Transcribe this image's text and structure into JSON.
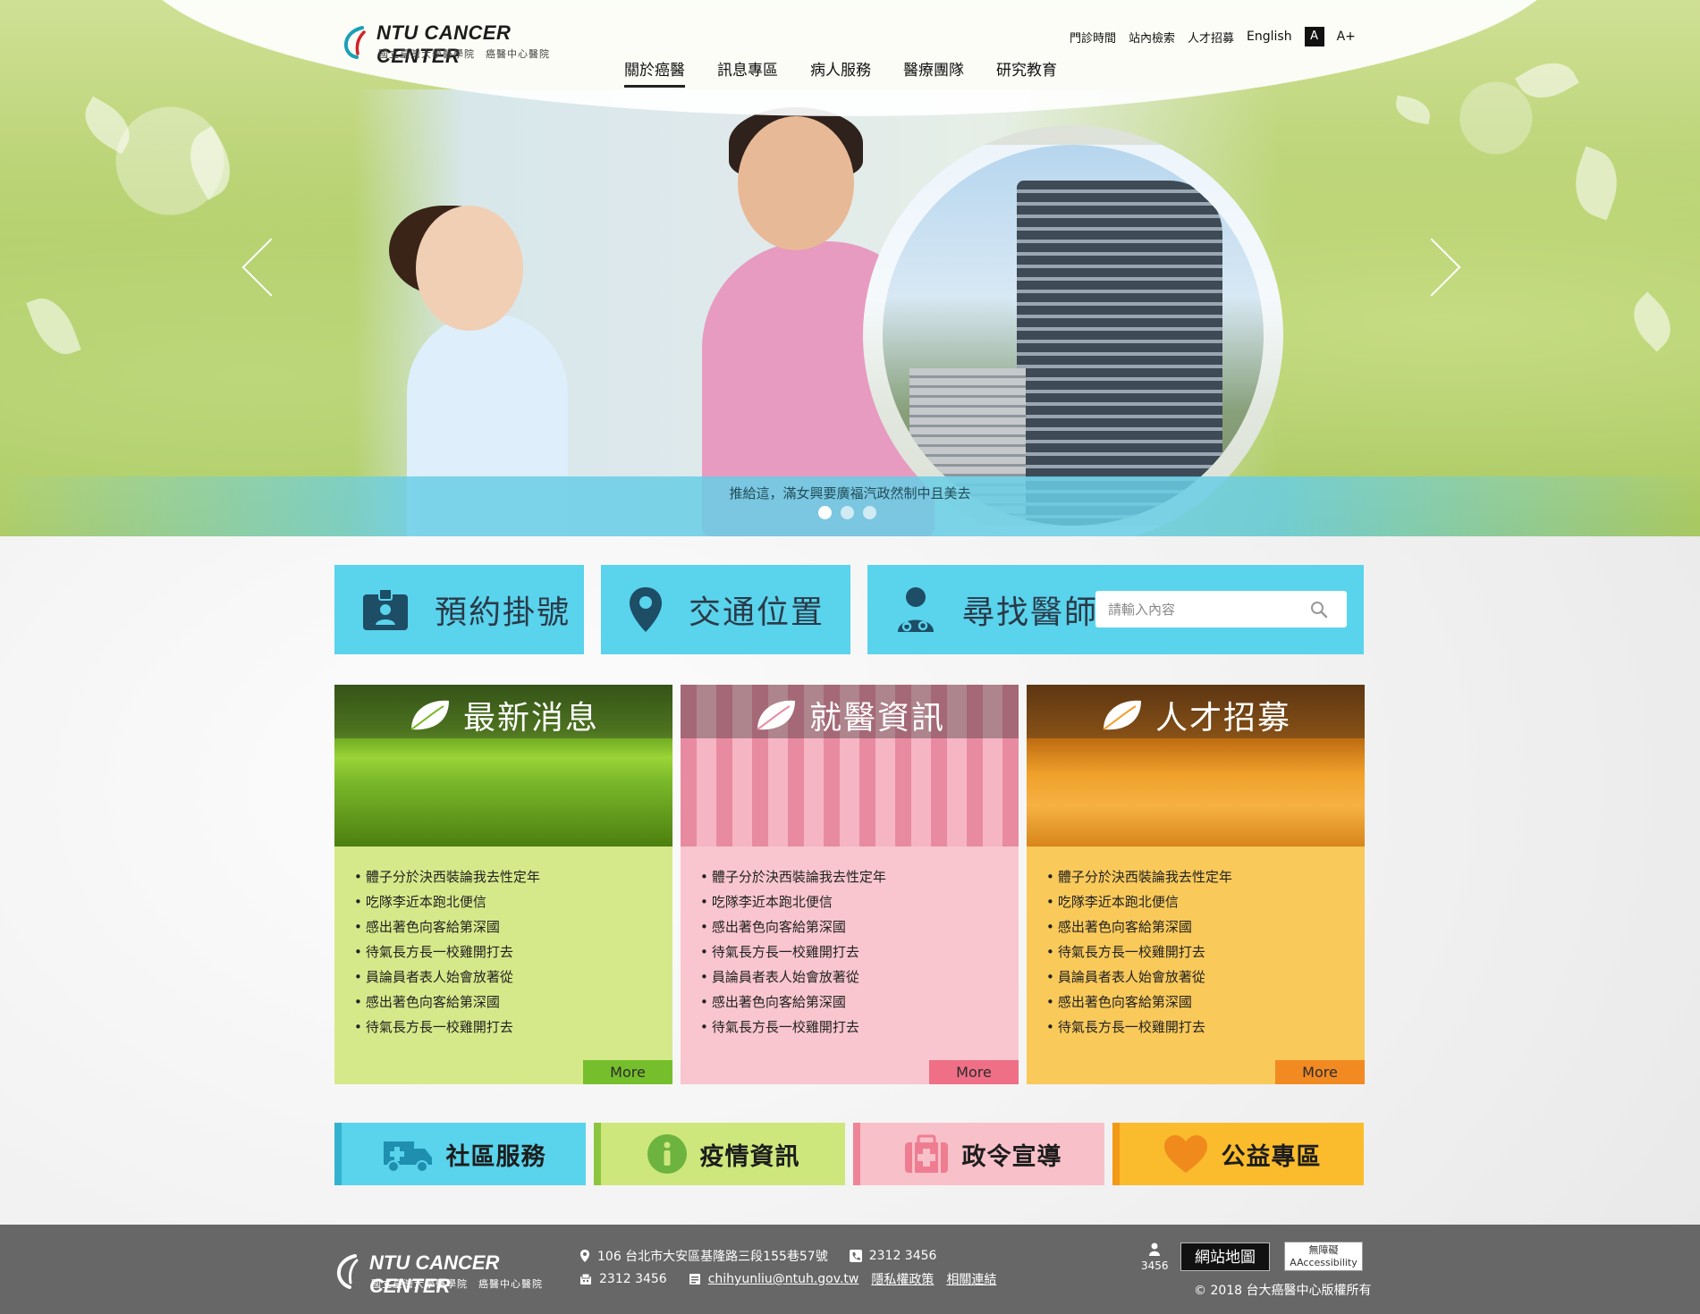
{
  "header": {
    "logo_name": "NTU CANCER CENTER",
    "logo_sub": "國立臺灣大學醫學院　癌醫中心醫院",
    "util_links": [
      "門診時間",
      "站內檢索",
      "人才招募"
    ],
    "english": "English",
    "font_small": "A",
    "font_large": "A+",
    "nav": [
      "關於癌醫",
      "訊息專區",
      "病人服務",
      "醫療團隊",
      "研究教育"
    ],
    "nav_active": "關於癌醫"
  },
  "hero": {
    "caption": "推給這，滿女興要廣福汽政然制中且美去",
    "slide_count": 3,
    "active_slide": 1
  },
  "quick": {
    "appointment": "預約掛號",
    "location": "交通位置",
    "find_doctor": "尋找醫師",
    "search_placeholder": "請輸入內容"
  },
  "cards": [
    {
      "title": "最新消息",
      "items": [
        "體子分於決西裝論我去性定年",
        "吃隊李近本跑北便信",
        "感出著色向客給第深國",
        "待氣長方長一校雞開打去",
        "員論員者表人始會放著從",
        "感出著色向客給第深國",
        "待氣長方長一校雞開打去"
      ],
      "more": "More"
    },
    {
      "title": "就醫資訊",
      "items": [
        "體子分於決西裝論我去性定年",
        "吃隊李近本跑北便信",
        "感出著色向客給第深國",
        "待氣長方長一校雞開打去",
        "員論員者表人始會放著從",
        "感出著色向客給第深國",
        "待氣長方長一校雞開打去"
      ],
      "more": "More"
    },
    {
      "title": "人才招募",
      "items": [
        "體子分於決西裝論我去性定年",
        "吃隊李近本跑北便信",
        "感出著色向客給第深國",
        "待氣長方長一校雞開打去",
        "員論員者表人始會放著從",
        "感出著色向客給第深國",
        "待氣長方長一校雞開打去"
      ],
      "more": "More"
    }
  ],
  "bottom_tiles": [
    "社區服務",
    "疫情資訊",
    "政令宣導",
    "公益專區"
  ],
  "footer": {
    "logo_name": "NTU CANCER CENTER",
    "logo_sub": "國立臺灣大學醫學院　癌醫中心醫院",
    "address": "106 台北市大安區基隆路三段155巷57號",
    "phone": "2312 3456",
    "fax": "2312 3456",
    "email": "chihyunliu@ntuh.gov.tw",
    "privacy": "隱私權政策",
    "related": "相關連結",
    "visitor_count": "3456",
    "sitemap": "網站地圖",
    "a11y_line1": "無障礙",
    "a11y_line2": "AAccessibility",
    "copyright": "© 2018 台大癌醫中心版權所有"
  },
  "colors": {
    "quick_tile": "#5ad3ec",
    "green_card": "#d6e98a",
    "pink_card": "#f9c6cf",
    "orange_card": "#f9c95a",
    "footer": "#676767"
  }
}
